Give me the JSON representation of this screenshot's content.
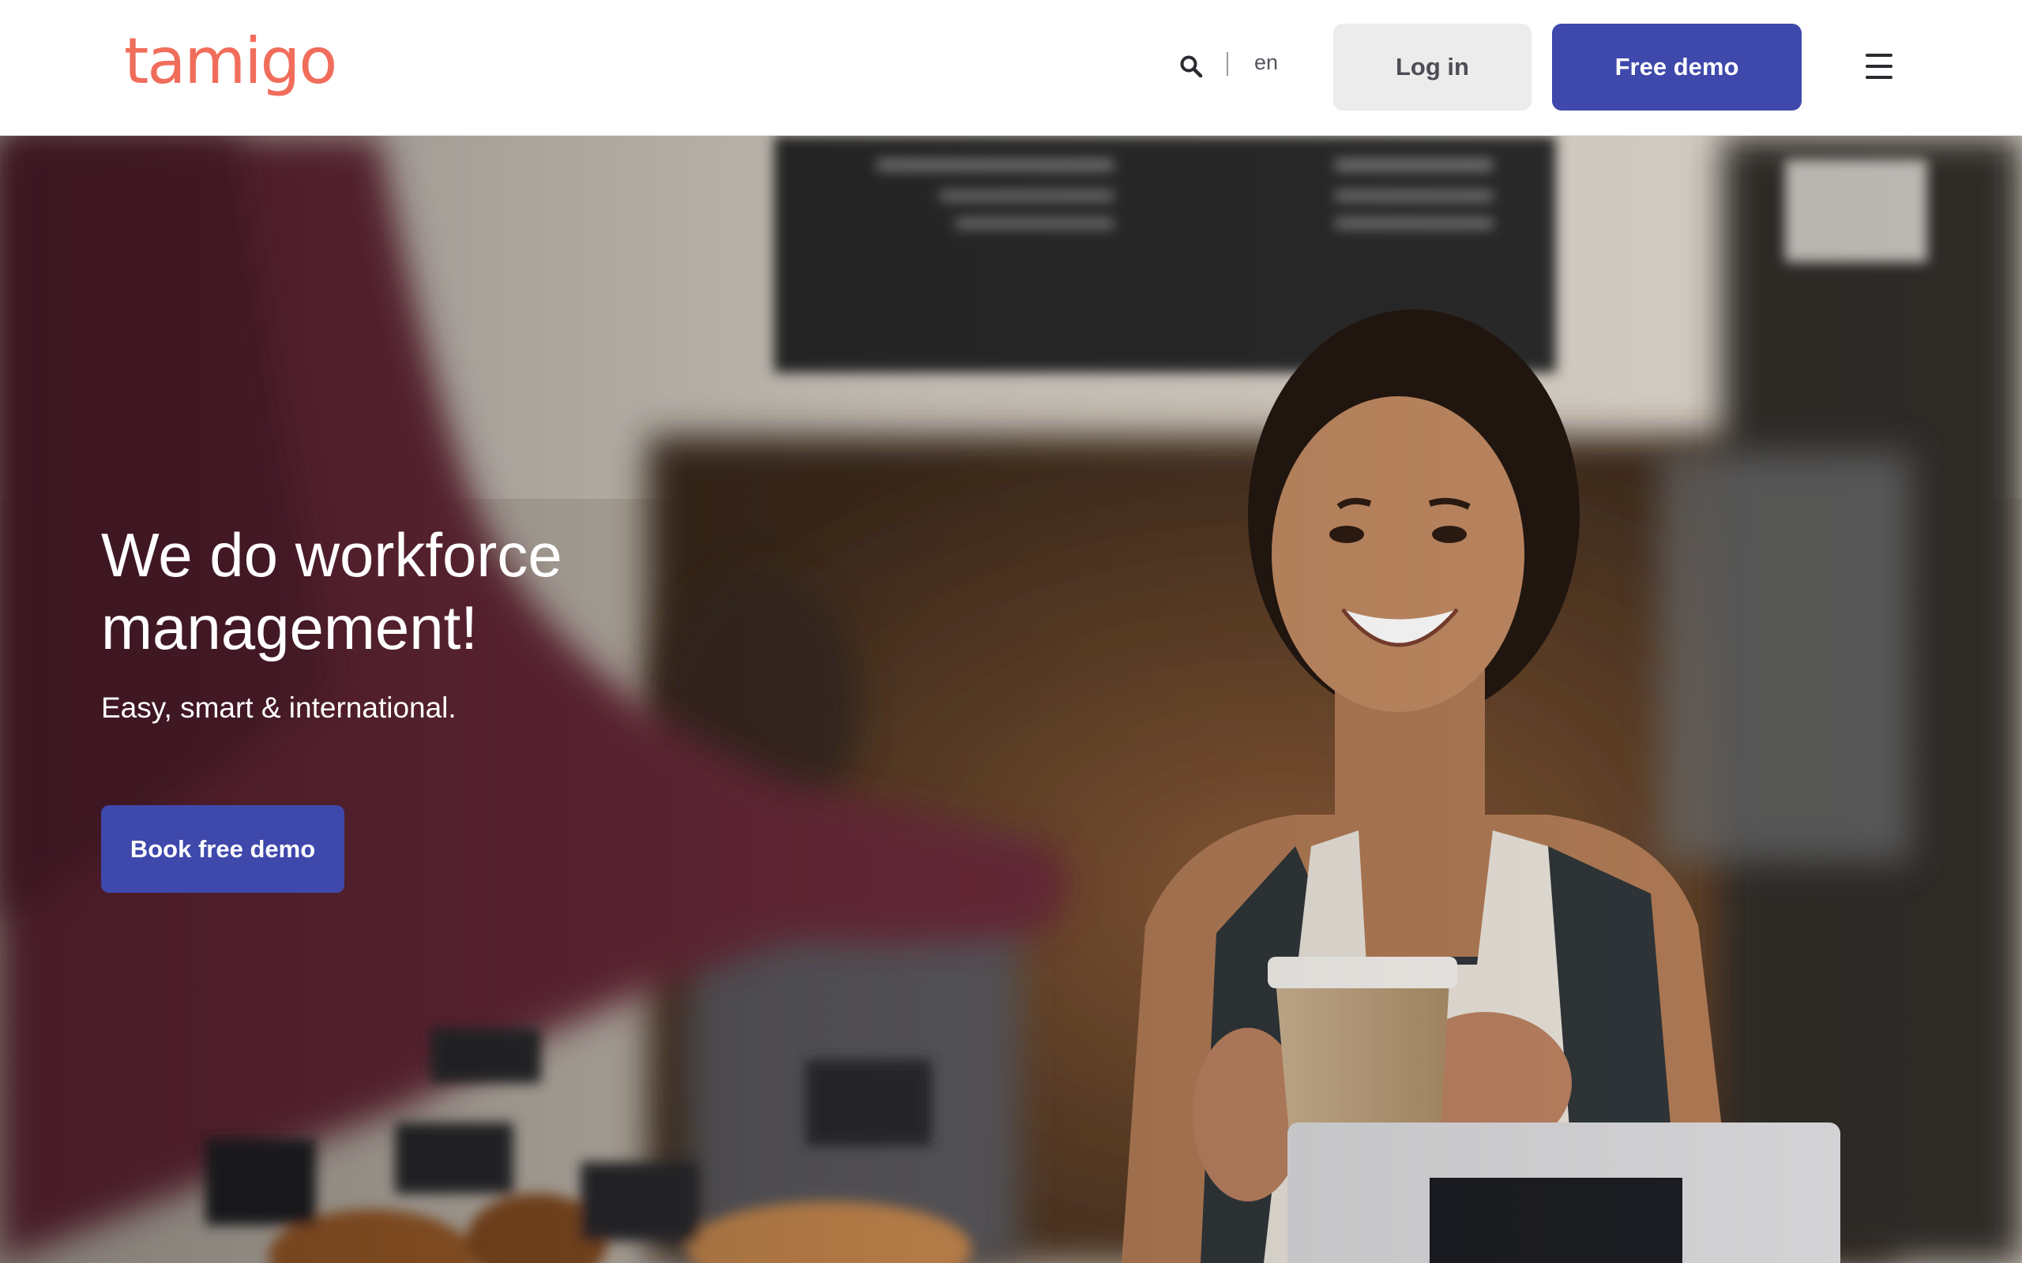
{
  "header": {
    "logo_text": "tamigo",
    "search_icon": "search-icon",
    "language": "en",
    "login_label": "Log in",
    "demo_label": "Free demo",
    "menu_icon": "hamburger-menu-icon"
  },
  "hero": {
    "title": "We do workforce management!",
    "subtitle": "Easy, smart & international.",
    "cta_label": "Book free demo"
  },
  "colors": {
    "brand_orange": "#f16d5b",
    "brand_blue": "#3f48ab",
    "login_bg": "#ececec"
  }
}
